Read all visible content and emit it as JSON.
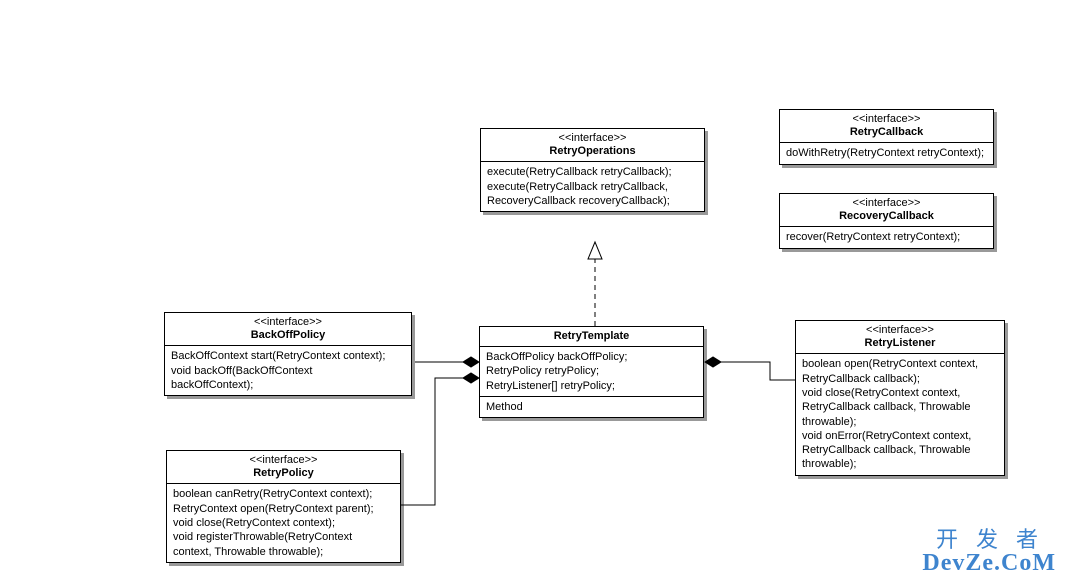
{
  "classes": {
    "retryOperations": {
      "stereotype": "<<interface>>",
      "name": "RetryOperations",
      "methods": "execute(RetryCallback retryCallback);\nexecute(RetryCallback retryCallback,\nRecoveryCallback recoveryCallback);"
    },
    "retryCallback": {
      "stereotype": "<<interface>>",
      "name": "RetryCallback",
      "methods": "doWithRetry(RetryContext retryContext);"
    },
    "recoveryCallback": {
      "stereotype": "<<interface>>",
      "name": "RecoveryCallback",
      "methods": "recover(RetryContext retryContext);"
    },
    "backOffPolicy": {
      "stereotype": "<<interface>>",
      "name": "BackOffPolicy",
      "methods": "BackOffContext start(RetryContext context);\nvoid backOff(BackOffContext\nbackOffContext);"
    },
    "retryTemplate": {
      "name": "RetryTemplate",
      "fields": "BackOffPolicy backOffPolicy;\nRetryPolicy retryPolicy;\nRetryListener[] retryPolicy;",
      "methods": "Method"
    },
    "retryListener": {
      "stereotype": "<<interface>>",
      "name": "RetryListener",
      "methods": "boolean open(RetryContext context,\nRetryCallback callback);\nvoid close(RetryContext context,\nRetryCallback callback, Throwable\nthrowable);\nvoid onError(RetryContext context,\nRetryCallback callback, Throwable\nthrowable);"
    },
    "retryPolicy": {
      "stereotype": "<<interface>>",
      "name": "RetryPolicy",
      "methods": "boolean canRetry(RetryContext context);\nRetryContext open(RetryContext parent);\nvoid close(RetryContext context);\nvoid registerThrowable(RetryContext\ncontext, Throwable throwable);"
    }
  },
  "watermark": {
    "cn": "开发者",
    "en": "DevZe.CoM"
  },
  "chart_data": {
    "type": "uml-class-diagram",
    "nodes": [
      {
        "id": "RetryOperations",
        "kind": "interface",
        "members": [
          "execute(RetryCallback retryCallback)",
          "execute(RetryCallback retryCallback, RecoveryCallback recoveryCallback)"
        ]
      },
      {
        "id": "RetryCallback",
        "kind": "interface",
        "members": [
          "doWithRetry(RetryContext retryContext)"
        ]
      },
      {
        "id": "RecoveryCallback",
        "kind": "interface",
        "members": [
          "recover(RetryContext retryContext)"
        ]
      },
      {
        "id": "BackOffPolicy",
        "kind": "interface",
        "members": [
          "BackOffContext start(RetryContext context)",
          "void backOff(BackOffContext backOffContext)"
        ]
      },
      {
        "id": "RetryTemplate",
        "kind": "class",
        "fields": [
          "BackOffPolicy backOffPolicy",
          "RetryPolicy retryPolicy",
          "RetryListener[] retryPolicy"
        ],
        "members": [
          "Method"
        ]
      },
      {
        "id": "RetryListener",
        "kind": "interface",
        "members": [
          "boolean open(RetryContext context, RetryCallback callback)",
          "void close(RetryContext context, RetryCallback callback, Throwable throwable)",
          "void onError(RetryContext context, RetryCallback callback, Throwable throwable)"
        ]
      },
      {
        "id": "RetryPolicy",
        "kind": "interface",
        "members": [
          "boolean canRetry(RetryContext context)",
          "RetryContext open(RetryContext parent)",
          "void close(RetryContext context)",
          "void registerThrowable(RetryContext context, Throwable throwable)"
        ]
      }
    ],
    "edges": [
      {
        "from": "RetryTemplate",
        "to": "RetryOperations",
        "type": "realization"
      },
      {
        "from": "RetryTemplate",
        "to": "BackOffPolicy",
        "type": "composition"
      },
      {
        "from": "RetryTemplate",
        "to": "RetryPolicy",
        "type": "composition"
      },
      {
        "from": "RetryTemplate",
        "to": "RetryListener",
        "type": "composition"
      }
    ]
  }
}
